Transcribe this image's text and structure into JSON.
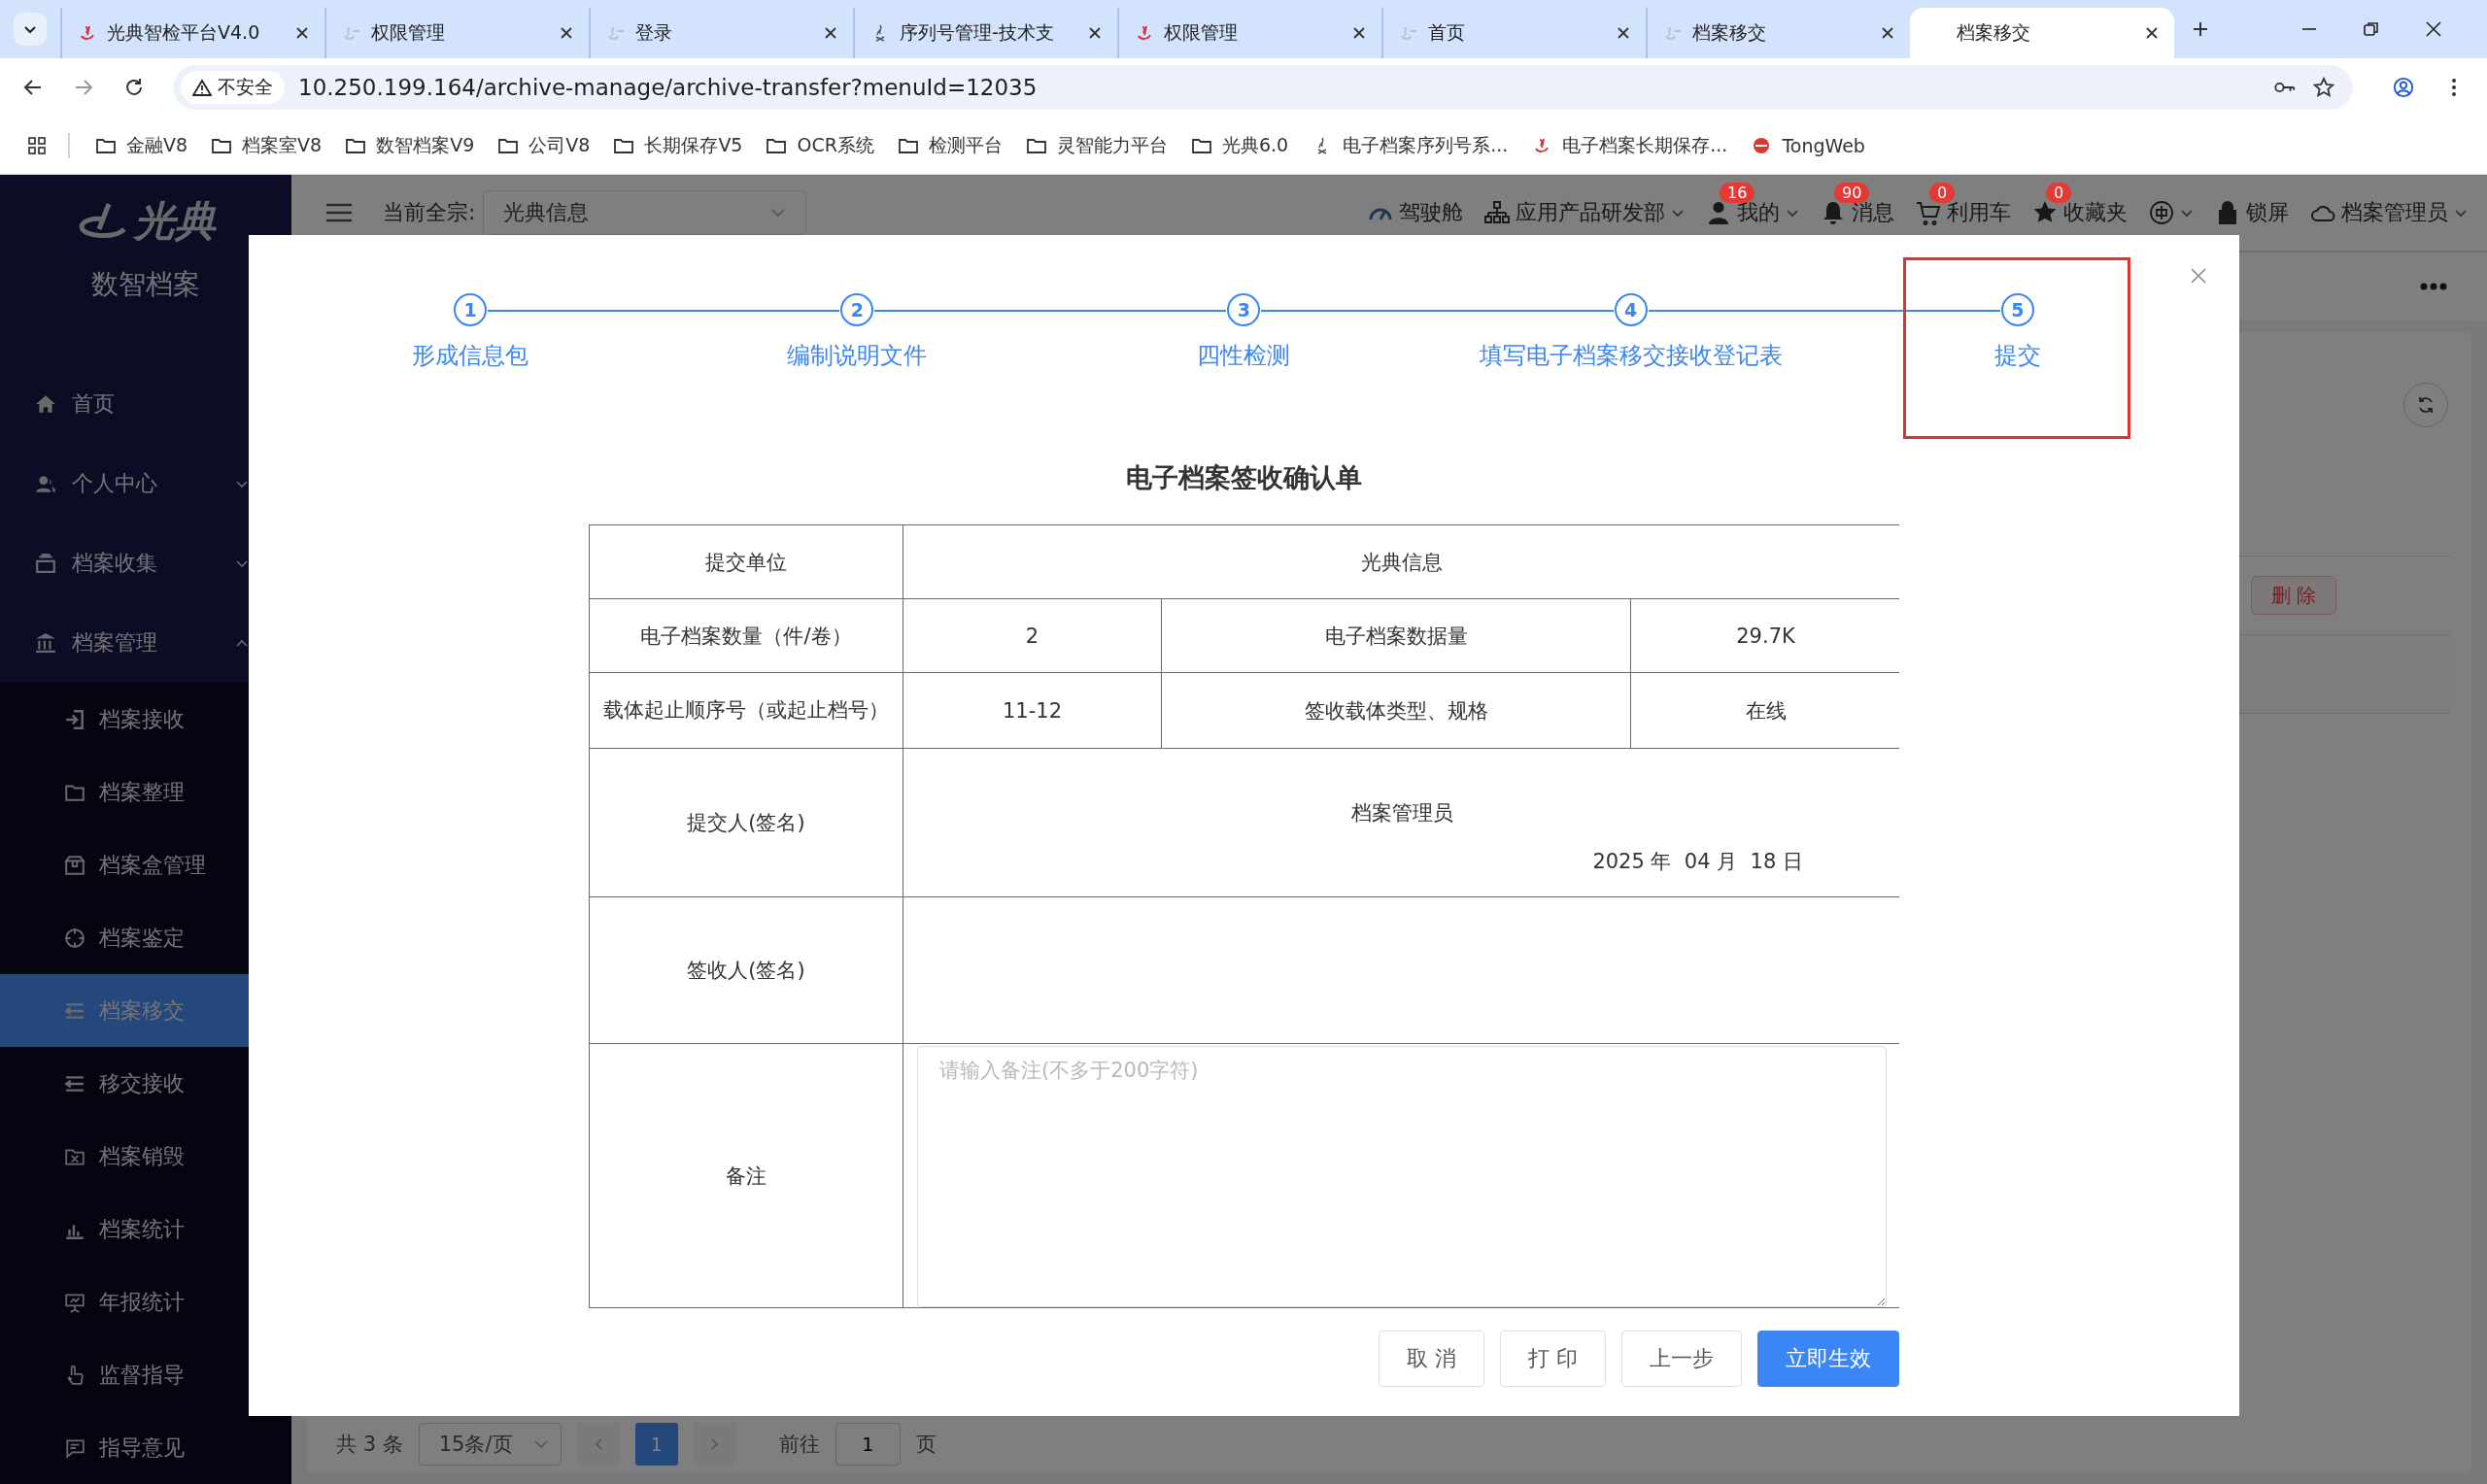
{
  "browser": {
    "tabs": [
      {
        "title": "光典智检平台V4.0",
        "selected": false
      },
      {
        "title": "权限管理",
        "selected": false
      },
      {
        "title": "登录",
        "selected": false
      },
      {
        "title": "序列号管理-技术支",
        "selected": false
      },
      {
        "title": "权限管理",
        "selected": false
      },
      {
        "title": "首页",
        "selected": false
      },
      {
        "title": "档案移交",
        "selected": false
      },
      {
        "title": "档案移交",
        "selected": true
      }
    ],
    "address": {
      "security": "不安全",
      "url": "10.250.199.164/archive-manage/archive-transfer?menuId=12035"
    },
    "bookmarks": [
      "金融V8",
      "档案室V8",
      "数智档案V9",
      "公司V8",
      "长期保存V5",
      "OCR系统",
      "检测平台",
      "灵智能力平台",
      "光典6.0",
      "电子档案序列号系...",
      "电子档案长期保存...",
      "TongWeb"
    ]
  },
  "app": {
    "logo": "光典",
    "product": "数智档案",
    "sidebar": {
      "items": [
        {
          "label": "首页"
        },
        {
          "label": "个人中心",
          "expanded": false
        },
        {
          "label": "档案收集",
          "expanded": false
        },
        {
          "label": "档案管理",
          "expanded": true,
          "children": [
            {
              "label": "档案接收",
              "selected": false
            },
            {
              "label": "档案整理",
              "selected": false
            },
            {
              "label": "档案盒管理",
              "selected": false
            },
            {
              "label": "档案鉴定",
              "selected": false
            },
            {
              "label": "档案移交",
              "selected": true
            },
            {
              "label": "移交接收",
              "selected": false
            },
            {
              "label": "档案销毁",
              "selected": false
            },
            {
              "label": "档案统计",
              "selected": false
            },
            {
              "label": "年报统计",
              "selected": false
            },
            {
              "label": "监督指导",
              "selected": false
            },
            {
              "label": "指导意见",
              "selected": false
            }
          ]
        }
      ]
    },
    "header": {
      "fonds_label": "当前全宗:",
      "fonds_value": "光典信息",
      "items": [
        {
          "label": "驾驶舱",
          "dropdown": false
        },
        {
          "label": "应用产品研发部",
          "dropdown": true
        },
        {
          "label": "我的",
          "badge": "16",
          "dropdown": true
        },
        {
          "label": "消息",
          "badge": "90",
          "dropdown": false
        },
        {
          "label": "利用车",
          "badge": "0",
          "dropdown": false
        },
        {
          "label": "收藏夹",
          "badge": "0",
          "dropdown": false
        },
        {
          "dropdown": true
        },
        {
          "label": "锁屏",
          "dropdown": false
        },
        {
          "label": "档案管理员",
          "dropdown": true
        }
      ]
    },
    "content": {
      "delete_button": "删 除",
      "pagination": {
        "total": "共 3 条",
        "page_size": "15条/页",
        "pages": [
          {
            "label": "1",
            "selected": true
          }
        ],
        "goto_label": "前往",
        "goto_value": "1",
        "goto_suffix": "页"
      }
    }
  },
  "modal": {
    "steps": [
      {
        "number": "1",
        "label": "形成信息包",
        "highlighted": false
      },
      {
        "number": "2",
        "label": "编制说明文件",
        "highlighted": false
      },
      {
        "number": "3",
        "label": "四性检测",
        "highlighted": false
      },
      {
        "number": "4",
        "label": "填写电子档案移交接收登记表",
        "highlighted": false
      },
      {
        "number": "5",
        "label": "提交",
        "highlighted": true
      }
    ],
    "form": {
      "title": "电子档案签收确认单",
      "submitting_unit": {
        "label": "提交单位",
        "value": "光典信息"
      },
      "count": {
        "label": "电子档案数量（件/卷）",
        "value": "2"
      },
      "data_volume": {
        "label": "电子档案数据量",
        "value": "29.7K"
      },
      "carrier_range": {
        "label": "载体起止顺序号（或起止档号）",
        "value": "11-12"
      },
      "carrier_type": {
        "label": "签收载体类型、规格",
        "value": "在线"
      },
      "submitter": {
        "label": "提交人(签名)",
        "name": "档案管理员",
        "date": "2025 年  04 月  18 日"
      },
      "receiver": {
        "label": "签收人(签名)"
      },
      "remark": {
        "label": "备注",
        "placeholder": "请输入备注(不多于200字符)"
      }
    },
    "buttons": [
      {
        "label": "取 消",
        "kind": "default"
      },
      {
        "label": "打 印",
        "kind": "default"
      },
      {
        "label": "上一步",
        "kind": "default"
      },
      {
        "label": "立即生效",
        "kind": "primary"
      }
    ]
  }
}
